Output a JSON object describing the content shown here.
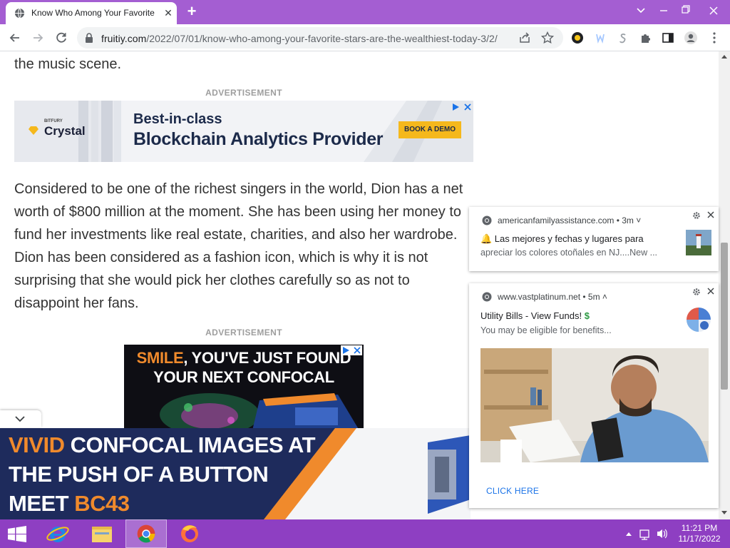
{
  "browser": {
    "tab_title": "Know Who Among Your Favorite",
    "url_domain": "fruitiy.com",
    "url_path": "/2022/07/01/know-who-among-your-favorite-stars-are-the-wealthiest-today-3/2/"
  },
  "article": {
    "top_text": "the music scene.",
    "ad_label_1": "ADVERTISEMENT",
    "paragraph": "Considered to be one of the richest singers in the world, Dion has a net worth of $800 million at the moment. She has been using her money to fund her investments like real estate, charities, and also her wardrobe. Dion has been considered as a fashion icon, which is why it is not surprising that she would pick her clothes carefully so as not to disappoint her fans.",
    "ad_label_2": "ADVERTISEMENT"
  },
  "banner_ad": {
    "brand_small": "BITFURY",
    "brand": "Crystal",
    "headline_1": "Best-in-class",
    "headline_2": "Blockchain Analytics Provider",
    "cta": "BOOK A DEMO"
  },
  "confocal_ad": {
    "line1_highlight": "SMILE",
    "line1_rest": ", YOU'VE JUST FOUND",
    "line2": "YOUR NEXT CONFOCAL"
  },
  "sticky_ad": {
    "line1_highlight": "VIVID",
    "line1_rest": " CONFOCAL IMAGES AT",
    "line2": "THE PUSH OF A BUTTON",
    "line3_prefix": "MEET ",
    "line3_highlight": "BC43"
  },
  "notifications": [
    {
      "origin": "americanfamilyassistance.com • 3m ˅",
      "title": "🔔 Las mejores y fechas y lugares para",
      "body": "apreciar los colores otoñales en NJ....New ..."
    },
    {
      "origin": "www.vastplatinum.net • 5m ˄",
      "title": "Utility Bills - View Funds!",
      "title_suffix": "$",
      "body": "You may be eligible for benefits...",
      "action": "CLICK HERE"
    }
  ],
  "taskbar": {
    "time": "11:21 PM",
    "date": "11/17/2022"
  },
  "colors": {
    "accent_purple": "#a45ed2",
    "taskbar": "#8e3fc2",
    "ad_orange": "#f08a2c",
    "cta_yellow": "#f5b81c"
  }
}
